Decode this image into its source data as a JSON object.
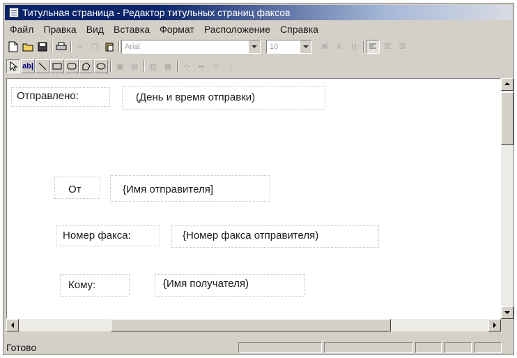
{
  "window": {
    "title": "Титульная страница - Редактор титульных страниц факсов"
  },
  "menu": [
    "Файл",
    "Правка",
    "Вид",
    "Вставка",
    "Формат",
    "Расположение",
    "Справка"
  ],
  "toolbar": {
    "font_name": "Arial",
    "font_size": "10"
  },
  "document": {
    "fields": [
      {
        "label": "Отправлено:",
        "value": "(День и время отправки)"
      },
      {
        "label": "От",
        "value": "{Имя отправителя]"
      },
      {
        "label": "Номер факса:",
        "value": "{Номер факса отправителя)"
      },
      {
        "label": "Кому:",
        "value": "{Имя получателя)"
      }
    ]
  },
  "status": {
    "text": "Готово"
  }
}
